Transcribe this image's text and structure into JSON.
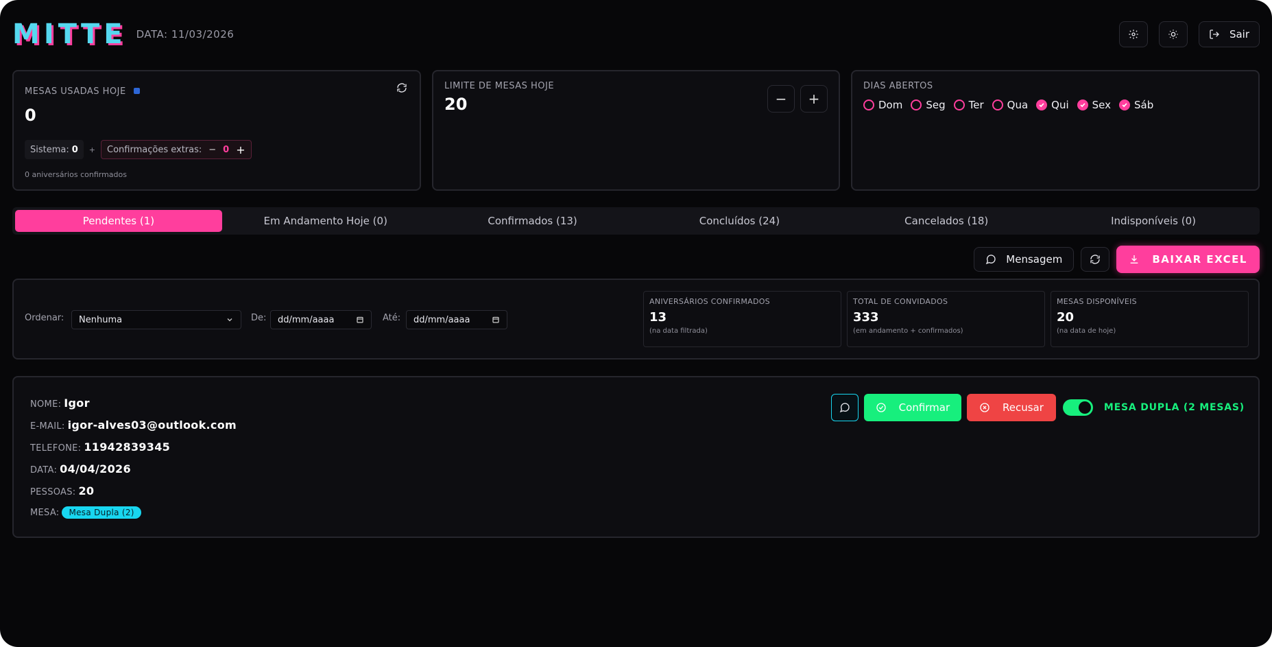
{
  "header": {
    "logo_letters": [
      "M",
      "I",
      "T",
      "T",
      "E"
    ],
    "date_label": "DATA: 11/03/2026",
    "exit_label": "Sair"
  },
  "cards": {
    "used": {
      "title": "MESAS USADAS HOJE",
      "value": "0",
      "system_label": "Sistema:",
      "system_value": "0",
      "plus": "+",
      "extra_label": "Confirmações extras:",
      "extra_minus": "−",
      "extra_value": "0",
      "extra_plus": "+",
      "note": "0 aniversários confirmados"
    },
    "limit": {
      "title": "LIMITE DE MESAS HOJE",
      "value": "20",
      "minus": "−",
      "plus": "+"
    },
    "days": {
      "title": "DIAS ABERTOS",
      "items": [
        {
          "label": "Dom",
          "on": false
        },
        {
          "label": "Seg",
          "on": false
        },
        {
          "label": "Ter",
          "on": false
        },
        {
          "label": "Qua",
          "on": false
        },
        {
          "label": "Qui",
          "on": true
        },
        {
          "label": "Sex",
          "on": true
        },
        {
          "label": "Sáb",
          "on": true
        }
      ]
    }
  },
  "tabs": [
    {
      "label": "Pendentes (1)",
      "active": true
    },
    {
      "label": "Em Andamento Hoje (0)",
      "active": false
    },
    {
      "label": "Confirmados (13)",
      "active": false
    },
    {
      "label": "Concluídos (24)",
      "active": false
    },
    {
      "label": "Cancelados (18)",
      "active": false
    },
    {
      "label": "Indisponíveis (0)",
      "active": false
    }
  ],
  "actions": {
    "message_label": "Mensagem",
    "excel_label": "BAIXAR EXCEL"
  },
  "filters": {
    "order_label": "Ordenar:",
    "order_value": "Nenhuma",
    "from_label": "De:",
    "from_placeholder": "dd/mm/aaaa",
    "to_label": "Até:",
    "to_placeholder": "dd/mm/aaaa",
    "stats": [
      {
        "label": "ANIVERSÁRIOS CONFIRMADOS",
        "value": "13",
        "sub": "(na data filtrada)"
      },
      {
        "label": "TOTAL DE CONVIDADOS",
        "value": "333",
        "sub": "(em andamento + confirmados)"
      },
      {
        "label": "MESAS DISPONÍVEIS",
        "value": "20",
        "sub": "(na data de hoje)"
      }
    ]
  },
  "reservation": {
    "name_label": "NOME:",
    "name": "Igor",
    "email_label": "E-MAIL:",
    "email": "igor-alves03@outlook.com",
    "phone_label": "TELEFONE:",
    "phone": "11942839345",
    "date_label": "DATA:",
    "date": "04/04/2026",
    "people_label": "PESSOAS:",
    "people": "20",
    "table_label": "MESA:",
    "table": "Mesa Dupla (2)",
    "confirm_label": "Confirmar",
    "refuse_label": "Recusar",
    "double_label": "MESA DUPLA (2 MESAS)"
  },
  "colors": {
    "accent_pink": "#ff3e9d",
    "accent_cyan": "#18d6f0",
    "success_green": "#17ef7d",
    "danger_red": "#ef4444"
  }
}
